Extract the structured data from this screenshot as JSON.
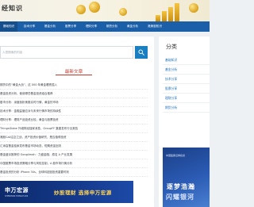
{
  "banner": {
    "title": "经知识"
  },
  "nav": {
    "items": [
      {
        "label": "基础知识"
      },
      {
        "label": "技术分享"
      },
      {
        "label": "基金分析"
      },
      {
        "label": "股票分享"
      },
      {
        "label": "理财分享"
      },
      {
        "label": "期货分析"
      },
      {
        "label": "黄金分析"
      },
      {
        "label": "港美股知识"
      }
    ]
  },
  "search": {
    "placeholder": "入您搜索的内容"
  },
  "latest": {
    "title": "最新文章",
    "items": [
      "期货中的“黄金大战”，这 000 年黄金看跌插入",
      "基金投资分析，使用哪些基金投资组合推荐",
      "股市分析：深度剖析美股实时行情，黄金的市场",
      "技术分享：金融监管应对与未来行情市场的持续性",
      "理财分享：理财产品投资比较，黄金与股票投资",
      "ThingsGlobe 外滩财经独家消息，GroupFF 集团发布行业报告",
      "港股Call沽空之战，资产投资价值研究，是否值得投资",
      "汇添富基金独家发布基金市场动态，短期资金回流",
      "基金盛京推荐的 Gonglimah · 力盛金融，原名 A 产业发展",
      "中国股票市场投资策略分享与风险控制，A 股市场行情分析",
      "基金投资的分析 iPhone 30s，全球科技股投资重要时刻"
    ]
  },
  "ad": {
    "logo": "申万宏源",
    "logo_sub": "SHENWAN HONGYUAN",
    "slogan": "炒股理财 选择申万宏源"
  },
  "sidebar": {
    "heading": "分类",
    "items": [
      {
        "label": "基础知识"
      },
      {
        "label": "基金分析"
      },
      {
        "label": "技术分享"
      },
      {
        "label": "股票分享"
      },
      {
        "label": "理财分享"
      },
      {
        "label": "期货分析"
      }
    ],
    "ad_top": "中国股票证券投资",
    "ad_line1": "逐梦浩瀚",
    "ad_line2": "闪耀银河"
  }
}
